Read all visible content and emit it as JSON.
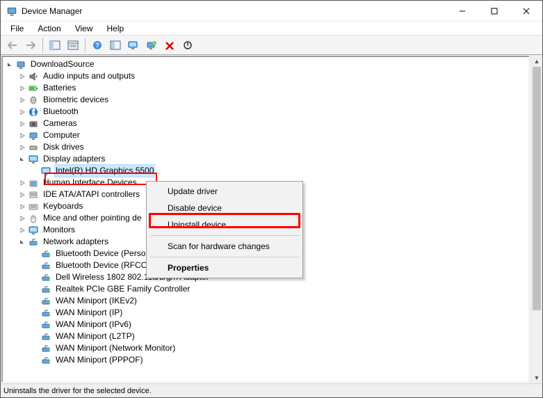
{
  "window": {
    "title": "Device Manager"
  },
  "menu": {
    "file": "File",
    "action": "Action",
    "view": "View",
    "help": "Help"
  },
  "tree": {
    "root": "DownloadSource",
    "items": {
      "audio": "Audio inputs and outputs",
      "batteries": "Batteries",
      "biometric": "Biometric devices",
      "bluetooth": "Bluetooth",
      "cameras": "Cameras",
      "computer": "Computer",
      "diskdrives": "Disk drives",
      "display": "Display adapters",
      "display_child": "Intel(R) HD Graphics 5500",
      "hid": "Human Interface Devices",
      "ide": "IDE ATA/ATAPI controllers",
      "keyboards": "Keyboards",
      "mice": "Mice and other pointing de",
      "monitors": "Monitors",
      "network": "Network adapters",
      "net0": "Bluetooth Device (Perso",
      "net1": "Bluetooth Device (RFCOMM Protocol TDI)",
      "net2": "Dell Wireless 1802 802.11a/b/g/n Adapter",
      "net3": "Realtek PCIe GBE Family Controller",
      "net4": "WAN Miniport (IKEv2)",
      "net5": "WAN Miniport (IP)",
      "net6": "WAN Miniport (IPv6)",
      "net7": "WAN Miniport (L2TP)",
      "net8": "WAN Miniport (Network Monitor)",
      "net9": "WAN Miniport (PPPOF)"
    }
  },
  "context_menu": {
    "update": "Update driver",
    "disable": "Disable device",
    "uninstall": "Uninstall device",
    "scan": "Scan for hardware changes",
    "properties": "Properties"
  },
  "statusbar": {
    "text": "Uninstalls the driver for the selected device."
  }
}
